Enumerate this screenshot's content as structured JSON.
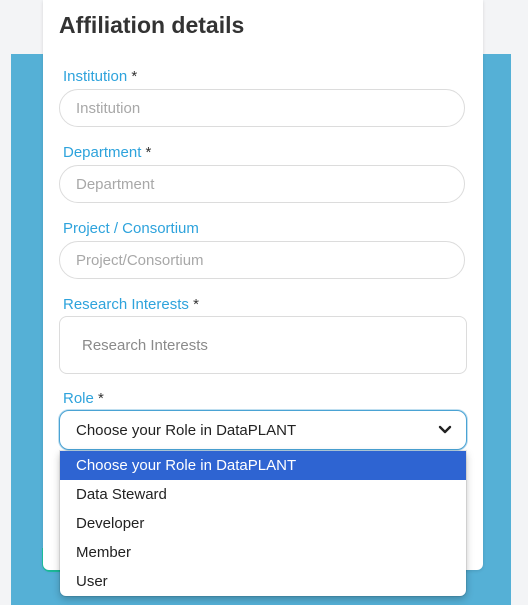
{
  "form": {
    "title": "Affiliation details",
    "required_mark": "*",
    "institution": {
      "label": "Institution",
      "placeholder": "Institution",
      "value": ""
    },
    "department": {
      "label": "Department",
      "placeholder": "Department",
      "value": ""
    },
    "project": {
      "label": "Project / Consortium",
      "placeholder": "Project/Consortium",
      "value": ""
    },
    "research": {
      "label": "Research Interests",
      "placeholder": "Research Interests",
      "value": ""
    },
    "role": {
      "label": "Role",
      "selected": "Choose your Role in DataPLANT",
      "options": [
        "Choose your Role in DataPLANT",
        "Data Steward",
        "Developer",
        "Member",
        "User"
      ],
      "highlighted_index": 0
    }
  },
  "colors": {
    "accent_label": "#2ea3dc",
    "background_blue": "#55b0d6",
    "teal": "#1ec4a2",
    "highlight": "#2e64d2"
  },
  "icons": {
    "role_dropdown": "chevron-down-icon"
  }
}
